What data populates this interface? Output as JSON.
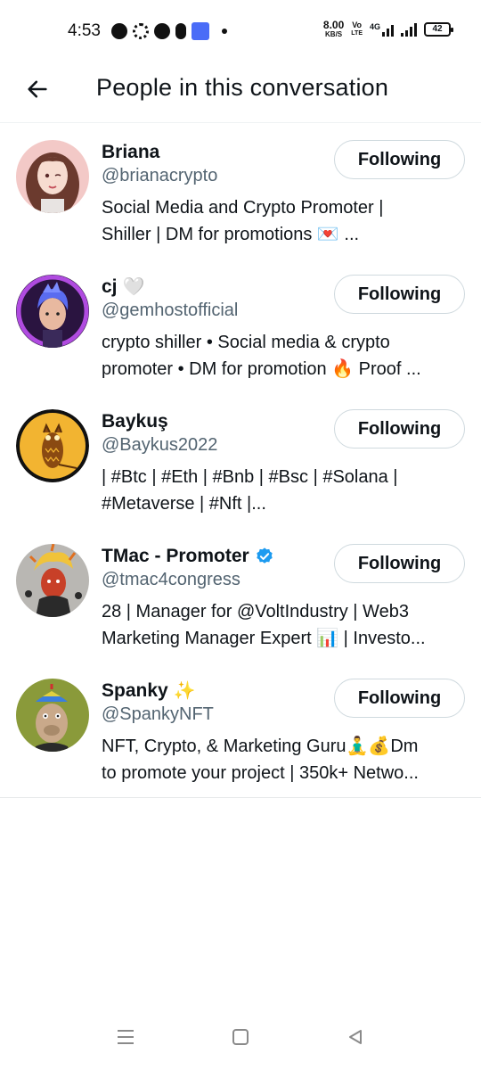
{
  "status_bar": {
    "time": "4:53",
    "speed_value": "8.00",
    "speed_unit": "KB/S",
    "net_badge_top": "Vo",
    "net_badge_bottom": "LTE",
    "network_type": "4G",
    "battery": "42"
  },
  "header": {
    "title": "People in this conversation",
    "back_icon": "arrow-left-icon"
  },
  "people": [
    {
      "name": "Briana",
      "emoji": "",
      "verified": false,
      "handle": "@brianacrypto",
      "bio_line1": "Social Media and Crypto Promoter |",
      "bio_line2": "Shiller | DM for promotions 💌 ...",
      "button": "Following"
    },
    {
      "name": "cj",
      "emoji": "🤍",
      "verified": false,
      "handle": "@gemhostofficial",
      "bio_line1": "crypto shiller • Social media & crypto",
      "bio_line2": "promoter • DM for promotion 🔥 Proof ...",
      "button": "Following"
    },
    {
      "name": "Baykuş",
      "emoji": "",
      "verified": false,
      "handle": "@Baykus2022",
      "bio_line1": "| #Btc | #Eth | #Bnb | #Bsc | #Solana |",
      "bio_line2": "#Metaverse | #Nft |...",
      "button": "Following"
    },
    {
      "name": "TMac - Promoter",
      "emoji": "",
      "verified": true,
      "handle": "@tmac4congress",
      "bio_line1": "28 | Manager for @VoltIndustry | Web3",
      "bio_line2": "Marketing Manager Expert 📊 | Investo...",
      "button": "Following"
    },
    {
      "name": "Spanky",
      "emoji": "✨",
      "verified": false,
      "handle": "@SpankyNFT",
      "bio_line1": "NFT, Crypto, & Marketing Guru🧘‍♂️💰Dm",
      "bio_line2": "to promote your project | 350k+ Netwo...",
      "button": "Following"
    }
  ],
  "colors": {
    "text_primary": "#0f1419",
    "text_secondary": "#536471",
    "border": "#cfd9de",
    "verified_blue": "#1d9bf0"
  },
  "nav_bar": {
    "recents_icon": "menu-icon",
    "home_icon": "square-icon",
    "back_icon": "triangle-back-icon"
  }
}
